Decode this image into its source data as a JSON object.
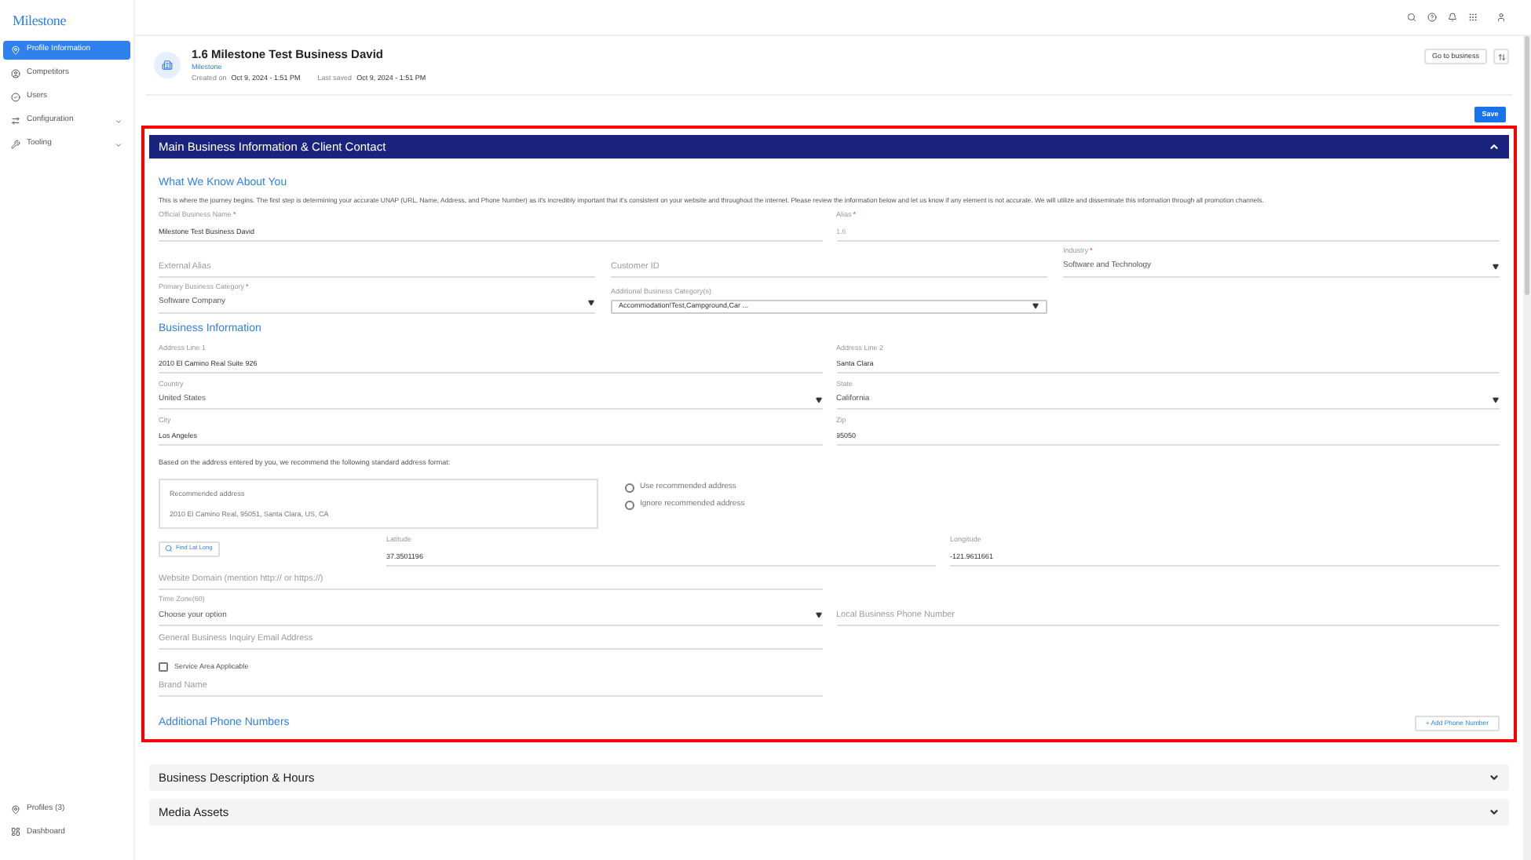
{
  "sidebar": {
    "logo": "Milestone",
    "items": [
      {
        "label": "Profile Information",
        "selected": true,
        "expandable": false
      },
      {
        "label": "Competitors",
        "selected": false,
        "expandable": false
      },
      {
        "label": "Users",
        "selected": false,
        "expandable": false
      },
      {
        "label": "Configuration",
        "selected": false,
        "expandable": true
      },
      {
        "label": "Tooling",
        "selected": false,
        "expandable": true
      }
    ],
    "bottom_items": [
      {
        "label": "Profiles (3)"
      },
      {
        "label": "Dashboard"
      }
    ]
  },
  "header": {
    "title": "1.6 Milestone Test Business David",
    "subtitle": "Milestone",
    "created_label": "Created on",
    "created_value": "Oct 9, 2024 - 1:51 PM",
    "saved_label": "Last saved",
    "saved_value": "Oct 9, 2024 - 1:51 PM",
    "go_button": "Go to business"
  },
  "save_button": "Save",
  "main_section": {
    "title": "Main Business Information & Client Contact",
    "expanded": true,
    "blocks": [
      {
        "kind": "heading",
        "text": "What We Know About You"
      },
      {
        "kind": "paragraph",
        "text": "This is where the journey begins. The first step is determining your accurate UNAP (URL, Name, Address, and Phone Number) as it's incredibly important that it's consistent on your website and throughout the internet. Please review the information below and let us know if any element is not accurate. We will utilize and disseminate this information through all promotion channels."
      },
      {
        "kind": "row",
        "fields": [
          {
            "kind": "text",
            "label": "Official Business Name",
            "mark": "*",
            "value": "Milestone Test Business David",
            "disabled": false
          },
          {
            "kind": "text",
            "label": "Alias",
            "mark": "*",
            "value": "1.6",
            "disabled": true
          }
        ]
      },
      {
        "kind": "row",
        "fields": [
          {
            "kind": "text",
            "placeholder": "External Alias"
          },
          {
            "kind": "text",
            "placeholder": "Customer ID"
          },
          {
            "kind": "select",
            "label": "Industry",
            "mark": "*",
            "value": "Software and Technology"
          }
        ]
      },
      {
        "kind": "row_thirds",
        "fields": [
          {
            "kind": "select",
            "label": "Primary Business Category",
            "mark": "*",
            "value": "Software Company"
          },
          {
            "kind": "boxed_select",
            "label": "Additional Business Category(s)",
            "value": "Accommodation!Test,Campground,Car ..."
          }
        ]
      },
      {
        "kind": "heading",
        "text": "Business Information"
      },
      {
        "kind": "row",
        "fields": [
          {
            "kind": "text",
            "label": "Address Line 1",
            "value": "2010 El Camino Real Suite 926",
            "disabled": false
          },
          {
            "kind": "text",
            "label": "Address Line 2",
            "value": "Santa Clara",
            "disabled": false
          }
        ]
      },
      {
        "kind": "row",
        "fields": [
          {
            "kind": "select",
            "label": "Country",
            "value": "United States"
          },
          {
            "kind": "select",
            "label": "State",
            "value": "California"
          }
        ]
      },
      {
        "kind": "row",
        "fields": [
          {
            "kind": "text",
            "label": "City",
            "value": "Los Angeles",
            "disabled": false
          },
          {
            "kind": "text",
            "label": "Zip",
            "value": "95050",
            "disabled": false
          }
        ]
      },
      {
        "kind": "note",
        "text": "Based on the address entered by you, we recommend the following standard address format:"
      },
      {
        "kind": "suggestion",
        "box_label": "Recommended address",
        "address": "2010 El Camino Real, 95051, Santa Clara, US, CA",
        "options": [
          {
            "label": "Use recommended address",
            "selected": false
          },
          {
            "label": "Ignore recommended address",
            "selected": false
          }
        ]
      },
      {
        "kind": "geo",
        "button": "Find Lat Long",
        "fields": [
          {
            "kind": "text",
            "label": "Latitude",
            "value": "37.3501196",
            "disabled": false
          },
          {
            "kind": "text",
            "label": "Longitude",
            "value": "-121.9611661",
            "disabled": false
          }
        ]
      },
      {
        "kind": "row",
        "fields": [
          {
            "kind": "text",
            "placeholder": "Website Domain (mention http:// or https://)"
          }
        ]
      },
      {
        "kind": "row",
        "fields": [
          {
            "kind": "select",
            "label": "Time Zone(60)",
            "value": "Choose your option"
          },
          {
            "kind": "text",
            "placeholder": "Local Business Phone Number"
          }
        ]
      },
      {
        "kind": "row",
        "fields": [
          {
            "kind": "text",
            "placeholder": "General Business Inquiry Email Address"
          }
        ]
      },
      {
        "kind": "checkbox",
        "label": "Service Area Applicable",
        "checked": false
      },
      {
        "kind": "row",
        "fields": [
          {
            "kind": "text",
            "placeholder": "Brand Name"
          }
        ]
      },
      {
        "kind": "phones",
        "text": "Additional Phone Numbers",
        "button": "+ Add Phone Number"
      }
    ]
  },
  "collapsed_sections": [
    {
      "title": "Business Description & Hours",
      "expanded": false
    },
    {
      "title": "Media Assets",
      "expanded": false
    }
  ]
}
